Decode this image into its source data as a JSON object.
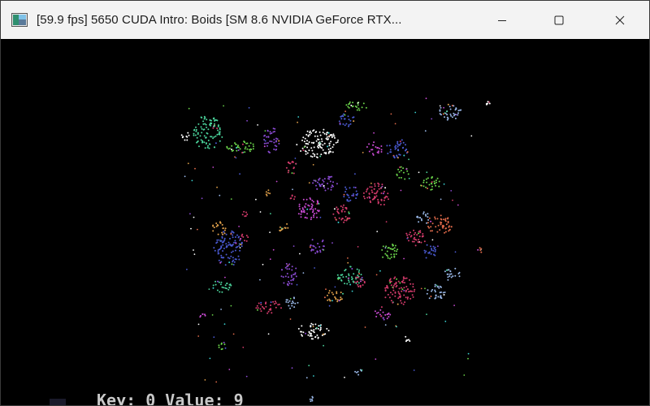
{
  "window": {
    "title": "[59.9 fps] 5650 CUDA Intro: Boids [SM 8.6 NVIDIA GeForce RTX...",
    "app_icon": "app-window-icon",
    "controls": {
      "minimize_icon": "minimize-icon",
      "maximize_icon": "maximize-icon",
      "close_icon": "close-icon"
    }
  },
  "background_console": {
    "text": "Key: 0 Value: 9"
  },
  "simulation": {
    "background_color": "#000000",
    "flock_colors": [
      "#4ad29a",
      "#8a4ad2",
      "#d23a6a",
      "#4a5ad2",
      "#9ab8e8",
      "#e06a4a",
      "#e0a04a",
      "#6ad24a",
      "#c84ad2",
      "#3ad2d2",
      "#ffffff"
    ]
  }
}
